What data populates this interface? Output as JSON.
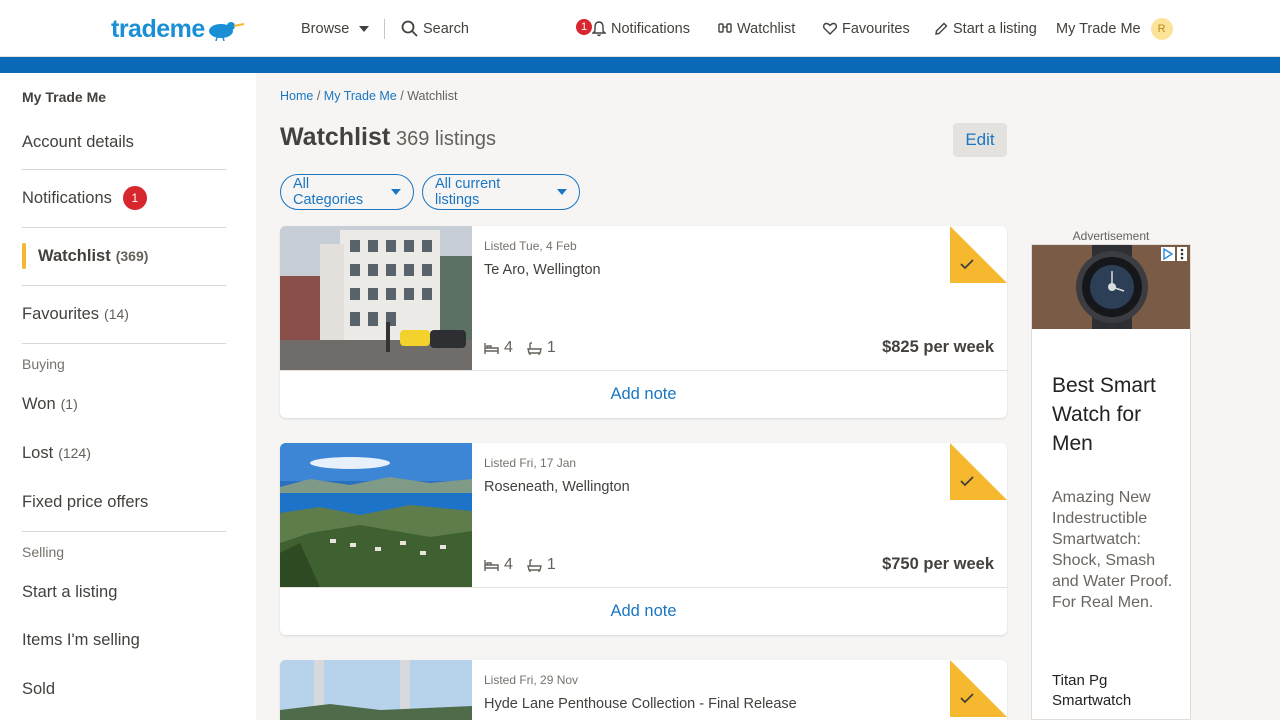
{
  "header": {
    "logo": {
      "part1": "trade",
      "part2": "me"
    },
    "browse_label": "Browse",
    "search_label": "Search",
    "notifications_label": "Notifications",
    "notifications_count": "1",
    "watchlist_label": "Watchlist",
    "favourites_label": "Favourites",
    "start_listing_label": "Start a listing",
    "my_trademe_label": "My Trade Me",
    "avatar_initial": "R"
  },
  "sidebar": {
    "title": "My Trade Me",
    "account_details": "Account details",
    "notifications": {
      "label": "Notifications",
      "badge": "1"
    },
    "watchlist": {
      "label": "Watchlist",
      "count": "(369)"
    },
    "favourites": {
      "label": "Favourites",
      "count": "(14)"
    },
    "buying_heading": "Buying",
    "won": {
      "label": "Won",
      "count": "(1)"
    },
    "lost": {
      "label": "Lost",
      "count": "(124)"
    },
    "fixed_price_offers": "Fixed price offers",
    "selling_heading": "Selling",
    "start_listing": "Start a listing",
    "items_selling": "Items I'm selling",
    "sold": "Sold"
  },
  "breadcrumb": {
    "home": "Home",
    "my_trademe": "My Trade Me",
    "current": "Watchlist",
    "sep": "/"
  },
  "main": {
    "title": "Watchlist",
    "subtitle": "369 listings",
    "edit_label": "Edit",
    "filter_categories": "All Categories",
    "filter_listings": "All current listings"
  },
  "listings": [
    {
      "date": "Listed Tue, 4 Feb",
      "location": "Te Aro, Wellington",
      "beds": "4",
      "baths": "1",
      "price": "$825 per week",
      "note": "Add note"
    },
    {
      "date": "Listed Fri, 17 Jan",
      "location": "Roseneath, Wellington",
      "beds": "4",
      "baths": "1",
      "price": "$750 per week",
      "note": "Add note"
    },
    {
      "date": "Listed Fri, 29 Nov",
      "location": "Hyde Lane Penthouse Collection - Final Release",
      "beds": "",
      "baths": "",
      "price": "",
      "note": ""
    }
  ],
  "ad": {
    "label": "Advertisement",
    "headline": "Best Smart Watch for Men",
    "body": "Amazing New Indestructible Smartwatch: Shock, Smash and Water Proof. For Real Men.",
    "brand": "Titan Pg Smartwatch"
  },
  "colors": {
    "brand_blue": "#0a6ab8",
    "link_blue": "#1a76c2",
    "badge_red": "#d7262e",
    "watch_yellow": "#f5b82e"
  }
}
